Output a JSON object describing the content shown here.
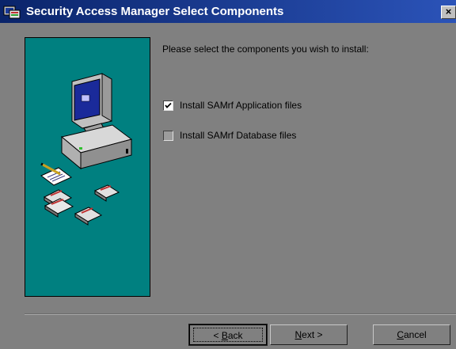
{
  "window": {
    "title": "Security Access Manager Select Components",
    "close_glyph": "×",
    "title_icon": "setup-icon"
  },
  "main": {
    "instruction": "Please select the components you wish to install:",
    "options": [
      {
        "label": "Install SAMrf Application files",
        "checked": true
      },
      {
        "label": "Install SAMrf Database files",
        "checked": false
      }
    ],
    "illustration": "computer-with-disks-illustration"
  },
  "buttons": {
    "back": {
      "prefix": "< ",
      "mnemonic": "B",
      "rest": "ack"
    },
    "next": {
      "mnemonic": "N",
      "rest": "ext >"
    },
    "cancel": {
      "mnemonic": "C",
      "rest": "ancel"
    }
  },
  "colors": {
    "titlebar": "#0a246a",
    "panel": "#008080",
    "dialog": "#808080"
  }
}
